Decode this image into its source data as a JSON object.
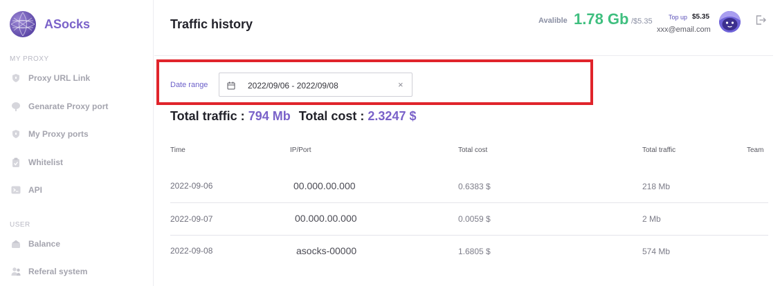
{
  "app": {
    "name": "ASocks"
  },
  "sidebar": {
    "sections": [
      {
        "label": "MY PROXY"
      },
      {
        "label": "USER"
      }
    ],
    "items": [
      {
        "label": "Proxy URL Link",
        "icon": "shield-icon"
      },
      {
        "label": "Genarate Proxy port",
        "icon": "tree-icon"
      },
      {
        "label": "My Proxy ports",
        "icon": "shield-icon"
      },
      {
        "label": "Whitelist",
        "icon": "clipboard-check-icon"
      },
      {
        "label": "API",
        "icon": "terminal-icon"
      },
      {
        "label": "Balance",
        "icon": "wallet-icon"
      },
      {
        "label": "Referal system",
        "icon": "users-icon"
      }
    ]
  },
  "header": {
    "title": "Traffic history",
    "available_label": "Avalible",
    "available_value": "1.78 Gb",
    "available_price": "/$5.35",
    "topup_label": "Top up",
    "topup_price": "$5.35",
    "email": "xxx@email.com"
  },
  "filter": {
    "label": "Date range",
    "value": "2022/09/06 - 2022/09/08",
    "clear": "×"
  },
  "totals": {
    "traffic_label": "Total traffic :",
    "traffic_value": "794 Mb",
    "cost_label": "Total cost :",
    "cost_value": "2.3247 $"
  },
  "table": {
    "columns": [
      "Time",
      "IP/Port",
      "Total cost",
      "Total traffic",
      "Team"
    ],
    "rows": [
      [
        "2022-09-06",
        "00.000.00.000",
        "0.6383 $",
        "218 Mb",
        ""
      ],
      [
        "2022-09-07",
        "00.000.00.000",
        "0.0059 $",
        "2 Mb",
        ""
      ],
      [
        "2022-09-08",
        "asocks-00000",
        "1.6805 $",
        "574 Mb",
        ""
      ]
    ]
  },
  "colors": {
    "brand": "#7a62c9",
    "available": "#3fbf7f",
    "highlight": "#e0242b"
  }
}
